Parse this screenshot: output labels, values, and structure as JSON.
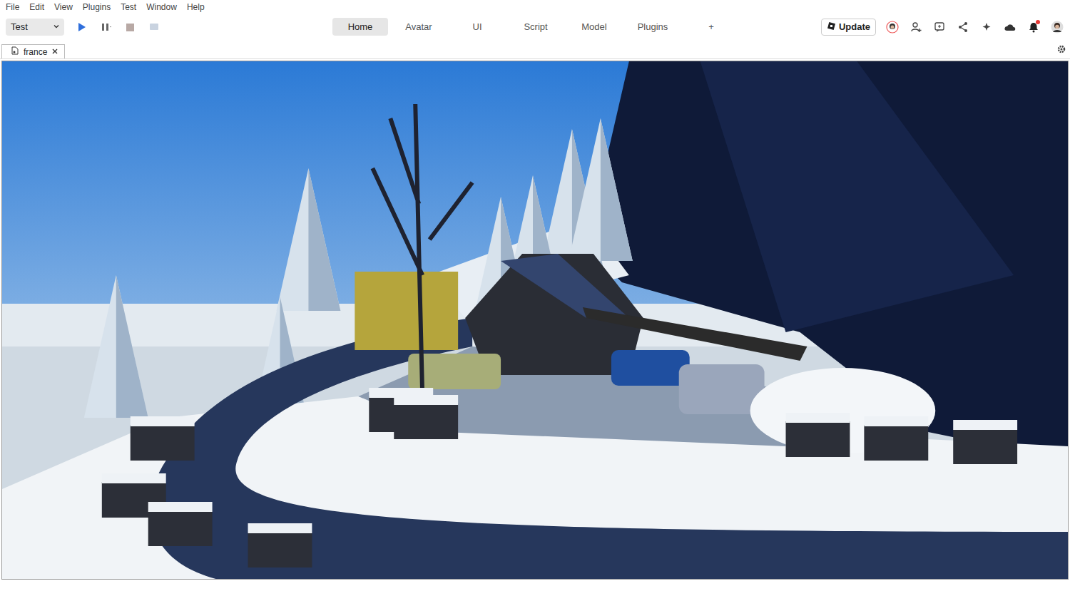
{
  "menu": [
    "File",
    "Edit",
    "View",
    "Plugins",
    "Test",
    "Window",
    "Help"
  ],
  "mode_select": {
    "value": "Test"
  },
  "ribbon_tabs": [
    {
      "label": "Home",
      "selected": true
    },
    {
      "label": "Avatar",
      "selected": false
    },
    {
      "label": "UI",
      "selected": false
    },
    {
      "label": "Script",
      "selected": false
    },
    {
      "label": "Model",
      "selected": false
    },
    {
      "label": "Plugins",
      "selected": false
    },
    {
      "label": "+",
      "selected": false
    }
  ],
  "update_button": {
    "label": "Update"
  },
  "notifications": {
    "unread": true
  },
  "document_tabs": [
    {
      "label": "france",
      "selected": true
    }
  ]
}
